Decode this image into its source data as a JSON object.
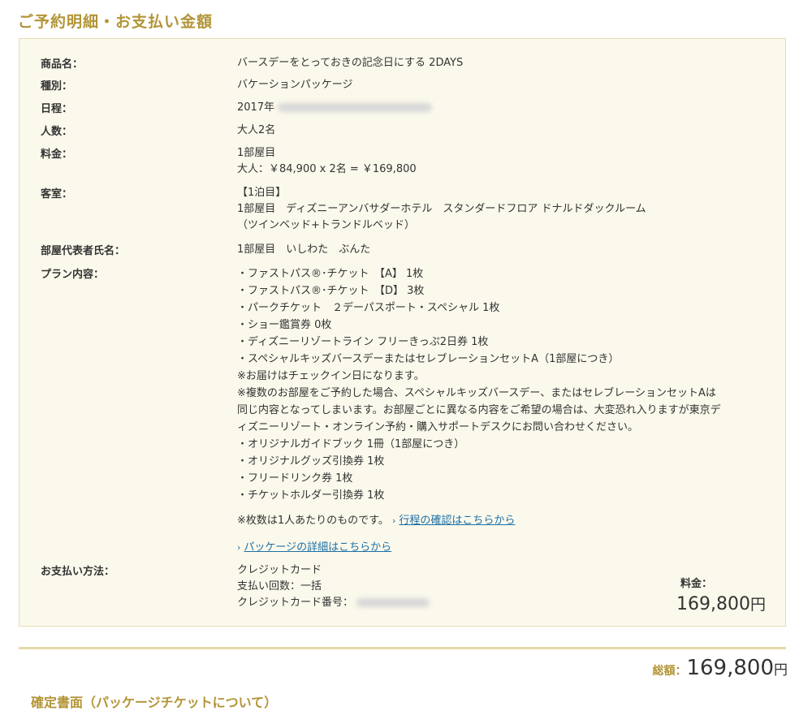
{
  "section_title": "ご予約明細・お支払い金額",
  "details": {
    "product": {
      "label": "商品名：",
      "value": "バースデーをとっておきの記念日にする 2DAYS"
    },
    "type": {
      "label": "種別：",
      "value": "バケーションパッケージ"
    },
    "schedule": {
      "label": "日程：",
      "value": "2017年"
    },
    "people": {
      "label": "人数：",
      "value": "大人2名"
    },
    "price": {
      "label": "料金：",
      "lines": [
        "1部屋目",
        "大人：￥84,900 x 2名 = ￥169,800"
      ]
    },
    "room": {
      "label": "客室：",
      "lines": [
        "【1泊目】",
        "1部屋目　ディズニーアンバサダーホテル　スタンダードフロア ドナルドダックルーム",
        "（ツインベッド+トランドルベッド）"
      ]
    },
    "representative": {
      "label": "部屋代表者氏名：",
      "value": "1部屋目　いしわた　ぶんた"
    },
    "plan": {
      "label": "プラン内容：",
      "lines": [
        "・ファストパス®･チケット　【A】 1枚",
        "・ファストパス®･チケット　【D】 3枚",
        "・パークチケット　２デーパスポート・スペシャル 1枚",
        "・ショー鑑賞券 0枚",
        "・ディズニーリゾートライン フリーきっぷ2日券 1枚",
        "・スペシャルキッズバースデーまたはセレブレーションセットA（1部屋につき）",
        "※お届けはチェックイン日になります。",
        "※複数のお部屋をご予約した場合、スペシャルキッズバースデー、またはセレブレーションセットAは",
        "同じ内容となってしまいます。お部屋ごとに異なる内容をご希望の場合は、大変恐れ入りますが東京デ",
        "ィズニーリゾート・オンライン予約・購入サポートデスクにお問い合わせください。",
        "・オリジナルガイドブック 1冊（1部屋につき）",
        "・オリジナルグッズ引換券 1枚",
        "・フリードリンク券 1枚",
        "・チケットホルダー引換券 1枚"
      ],
      "note": "※枚数は1人あたりのものです。",
      "itinerary_link": "行程の確認はこちらから",
      "package_link": "パッケージの詳細はこちらから"
    },
    "payment": {
      "label": "お支払い方法：",
      "lines": [
        "クレジットカード",
        "支払い回数：一括",
        "クレジットカード番号："
      ]
    }
  },
  "fee": {
    "label": "料金：",
    "amount": "169,800",
    "yen": "円"
  },
  "total": {
    "label": "総額：",
    "amount": "169,800",
    "yen": "円"
  },
  "next_section_title": "確定書面（パッケージチケットについて）"
}
